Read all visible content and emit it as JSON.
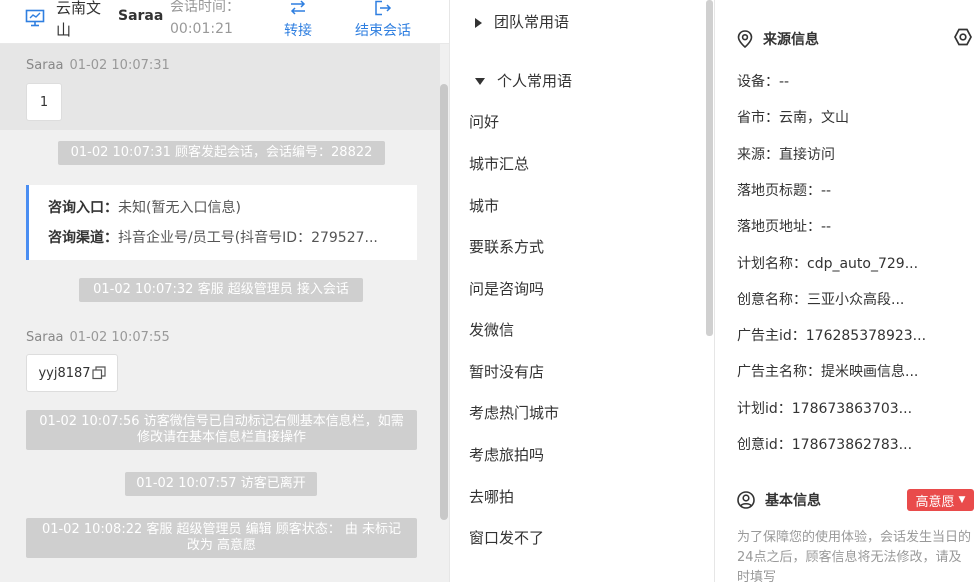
{
  "header": {
    "visitor_name": "云南文山",
    "agent_name": "Saraa",
    "time_label": "会话时间：",
    "time_value": "00:01:21",
    "transfer_label": "转接",
    "end_label": "结束会话"
  },
  "chat": {
    "msg1": {
      "sender": "Saraa",
      "time": "01-02 10:07:31",
      "text": "1"
    },
    "sys1": "01-02 10:07:31 顾客发起会话，会话编号：28822",
    "entry": {
      "k1": "咨询入口：",
      "v1": "未知(暂无入口信息)",
      "k2": "咨询渠道：",
      "v2": "抖音企业号/员工号(抖音号ID：279527..."
    },
    "sys2": "01-02 10:07:32 客服 超级管理员 接入会话",
    "msg2": {
      "sender": "Saraa",
      "time": "01-02 10:07:55",
      "text": "yyj8187"
    },
    "sys3": "01-02 10:07:56 访客微信号已自动标记右侧基本信息栏，如需修改请在基本信息栏直接操作",
    "sys4": "01-02 10:07:57 访客已离开",
    "sys5": "01-02 10:08:22 客服 超级管理员 编辑 顾客状态： 由 未标记 改为 高意愿"
  },
  "phrases": {
    "team_group": "团队常用语",
    "personal_group": "个人常用语",
    "items": [
      "问好",
      "城市汇总",
      "城市",
      "要联系方式",
      "问是咨询吗",
      "发微信",
      "暂时没有店",
      "考虑热门城市",
      "考虑旅拍吗",
      "去哪拍",
      "窗口发不了"
    ]
  },
  "info": {
    "source_title": "来源信息",
    "rows": [
      "设备：--",
      "省市：云南，文山",
      "来源：直接访问",
      "落地页标题：--",
      "落地页地址：--",
      "计划名称：cdp_auto_729...",
      "创意名称：三亚小众高段...",
      "广告主id：176285378923...",
      "广告主名称：提米映画信息...",
      "计划id：178673863703...",
      "创意id：178673862783..."
    ],
    "basic_title": "基本信息",
    "status_tag": "高意愿",
    "note": "为了保障您的使用体验，会话发生当日的24点之后，顾客信息将无法修改，请及时填写"
  },
  "colors": {
    "accent": "#2f7fe0",
    "danger": "#e94b4b",
    "system_pill": "#cfcfcf"
  }
}
